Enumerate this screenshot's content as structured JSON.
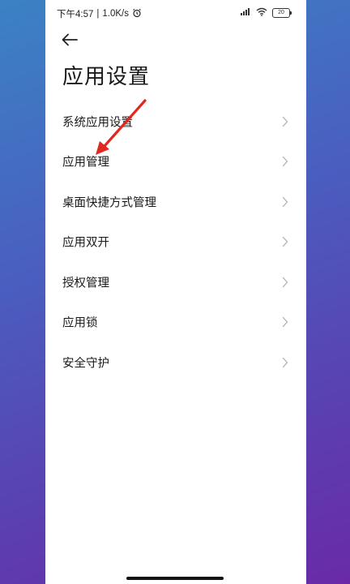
{
  "status_bar": {
    "time": "下午4:57",
    "separator": "|",
    "network_speed": "1.0K/s",
    "battery_level": "20",
    "icons": [
      "alarm-icon",
      "signal-icon",
      "wifi-icon",
      "battery-icon"
    ]
  },
  "header": {
    "back_icon": "back-arrow-icon",
    "title": "应用设置"
  },
  "menu": {
    "items": [
      {
        "label": "系统应用设置"
      },
      {
        "label": "应用管理"
      },
      {
        "label": "桌面快捷方式管理"
      },
      {
        "label": "应用双开"
      },
      {
        "label": "授权管理"
      },
      {
        "label": "应用锁"
      },
      {
        "label": "安全守护"
      }
    ]
  },
  "annotation": {
    "color": "#e0281e",
    "points_to": "应用管理"
  },
  "colors": {
    "background_top": "#3b82c4",
    "background_bottom": "#6a2aa8",
    "chevron": "#b0b0b0"
  }
}
